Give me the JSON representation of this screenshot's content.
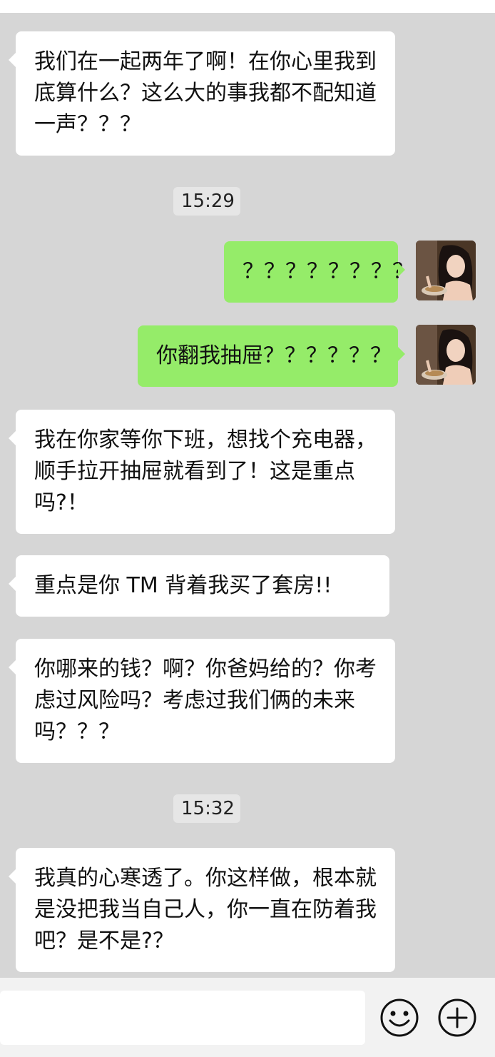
{
  "messages": [
    {
      "side": "left",
      "text": "我们在一起两年了啊！在你心里我到底算什么？这么大的事我都不配知道一声？？？"
    },
    {
      "side": "time",
      "text": "15:29"
    },
    {
      "side": "right",
      "text": "？？？？？？？？"
    },
    {
      "side": "right",
      "text": "你翻我抽屉？？？？？？"
    },
    {
      "side": "left",
      "text": "我在你家等你下班，想找个充电器，顺手拉开抽屉就看到了！这是重点吗?！"
    },
    {
      "side": "left",
      "text": "重点是你 TM 背着我买了套房!!"
    },
    {
      "side": "left",
      "text": "你哪来的钱？啊？你爸妈给的？你考虑过风险吗？考虑过我们俩的未来吗？？？"
    },
    {
      "side": "time",
      "text": "15:32"
    },
    {
      "side": "left",
      "text": "我真的心寒透了。你这样做，根本就是没把我当自己人，你一直在防着我吧？是不是?？"
    }
  ],
  "input": {
    "value": "",
    "placeholder": ""
  },
  "icons": {
    "emoji": "smiley-face-icon",
    "more": "plus-circle-icon"
  },
  "colors": {
    "chat_bg": "#d6d6d6",
    "sent_bubble": "#95ec69",
    "received_bubble": "#ffffff"
  }
}
